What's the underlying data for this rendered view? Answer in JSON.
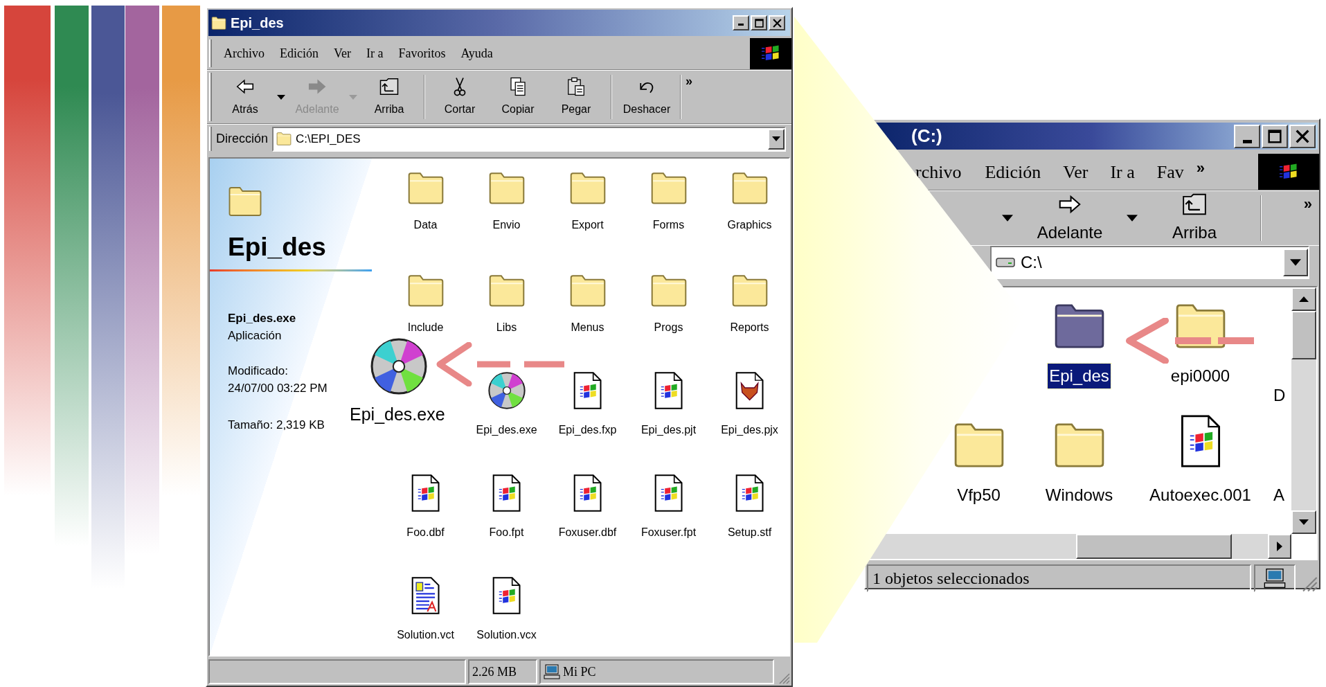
{
  "slide": {
    "stripes": [
      {
        "color": "#d6453c"
      },
      {
        "color": "#2f8a52"
      },
      {
        "color": "#4b5796"
      },
      {
        "color": "#a3659e"
      },
      {
        "color": "#e79a45"
      }
    ]
  },
  "main_window": {
    "title": "Epi_des",
    "menu": [
      "Archivo",
      "Edición",
      "Ver",
      "Ir a",
      "Favoritos",
      "Ayuda"
    ],
    "toolbar_groups": [
      {
        "buttons": [
          {
            "label": "Atrás",
            "kind": "back",
            "disabled": false,
            "dropdown": true
          },
          {
            "label": "Adelante",
            "kind": "forward",
            "disabled": true,
            "dropdown": true
          },
          {
            "label": "Arriba",
            "kind": "up",
            "disabled": false,
            "dropdown": false
          }
        ]
      },
      {
        "buttons": [
          {
            "label": "Cortar",
            "kind": "cut",
            "disabled": false,
            "dropdown": false
          },
          {
            "label": "Copiar",
            "kind": "copy",
            "disabled": false,
            "dropdown": false
          },
          {
            "label": "Pegar",
            "kind": "paste",
            "disabled": false,
            "dropdown": false
          }
        ]
      },
      {
        "buttons": [
          {
            "label": "Deshacer",
            "kind": "undo",
            "disabled": false,
            "dropdown": false
          }
        ]
      }
    ],
    "toolbar_overflow": "»",
    "address_label": "Dirección",
    "address": "C:\\EPI_DES",
    "info_panel": {
      "folder_name": "Epi_des",
      "file_name": "Epi_des.exe",
      "file_type": "Aplicación",
      "modified_label": "Modificado:",
      "modified": "24/07/00 03:22 PM",
      "size": "Tamaño: 2,319 KB"
    },
    "rows": [
      [
        {
          "name": "Data",
          "kind": "folder"
        },
        {
          "name": "Envio",
          "kind": "folder"
        },
        {
          "name": "Export",
          "kind": "folder"
        },
        {
          "name": "Forms",
          "kind": "folder"
        },
        {
          "name": "Graphics",
          "kind": "folder"
        }
      ],
      [
        {
          "name": "Include",
          "kind": "folder"
        },
        {
          "name": "Libs",
          "kind": "folder"
        },
        {
          "name": "Menus",
          "kind": "folder"
        },
        {
          "name": "Progs",
          "kind": "folder"
        },
        {
          "name": "Reports",
          "kind": "folder"
        }
      ],
      [
        null,
        {
          "name": "Epi_des.exe",
          "kind": "disc"
        },
        {
          "name": "Epi_des.fxp",
          "kind": "document"
        },
        {
          "name": "Epi_des.pjt",
          "kind": "document"
        },
        {
          "name": "Epi_des.pjx",
          "kind": "fox"
        }
      ],
      [
        {
          "name": "Foo.dbf",
          "kind": "document"
        },
        {
          "name": "Foo.fpt",
          "kind": "document"
        },
        {
          "name": "Foxuser.dbf",
          "kind": "document"
        },
        {
          "name": "Foxuser.fpt",
          "kind": "document"
        },
        {
          "name": "Setup.stf",
          "kind": "document"
        }
      ],
      [
        {
          "name": "Solution.vct",
          "kind": "text"
        },
        {
          "name": "Solution.vcx",
          "kind": "document"
        }
      ]
    ],
    "status_bar": {
      "size": "2.26 MB",
      "zone": "Mi PC"
    }
  },
  "callout": {
    "label": "Epi_des.exe"
  },
  "drive_window": {
    "title": "(C:)",
    "menu": [
      "rchivo",
      "Edición",
      "Ver",
      "Ir a",
      "Fav"
    ],
    "menu_overflow": "»",
    "toolbar": [
      {
        "label": "Adelante",
        "kind": "forward",
        "disabled": false
      },
      {
        "label": "Arriba",
        "kind": "up",
        "disabled": false
      }
    ],
    "toolbar_overflow": "»",
    "address": "C:\\",
    "rows": [
      [
        null,
        {
          "name": "Epi_des",
          "kind": "folder",
          "selected": true
        },
        {
          "name": "epi0000",
          "kind": "folder",
          "selected": false
        },
        {
          "name": "D",
          "kind": "partial"
        }
      ],
      [
        {
          "name": "Vfp50",
          "kind": "folder",
          "selected": false
        },
        {
          "name": "Windows",
          "kind": "folder",
          "selected": false
        },
        {
          "name": "Autoexec.001",
          "kind": "document",
          "selected": false
        },
        {
          "name": "A",
          "kind": "partial"
        }
      ]
    ],
    "status": "1 objetos seleccionados"
  }
}
